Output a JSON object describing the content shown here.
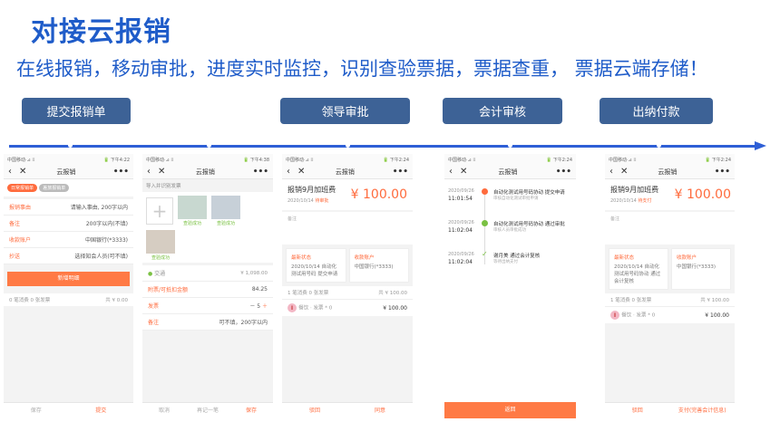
{
  "page": {
    "title": "对接云报销",
    "subtitle": "在线报销，移动审批，进度实时监控，识别查验票据，票据查重， 票据云端存储！"
  },
  "steps": [
    "提交报销单",
    "领导审批",
    "会计审核",
    "出纳付款"
  ],
  "colors": {
    "accent": "#1f5cc9",
    "step_bg": "#3d6296",
    "timeline": "#2e5fd6",
    "orange": "#ff6b3d",
    "green": "#7ac143"
  },
  "status": {
    "s1": {
      "l": "中国移动·⊿ ⁞⁞",
      "r": "🔋 下午4:22"
    },
    "s2": {
      "l": "中国移动·⊿ ⁞⁞",
      "r": "🔋 下午4:38"
    },
    "s3": {
      "l": "中国移动·⊿ ⁞⁞",
      "r": "🔋 下午2:24"
    },
    "s4": {
      "l": "中国移动·⊿ ⁞⁞",
      "r": "🔋 下午2:24"
    },
    "s5": {
      "l": "中国移动·⊿ ⁞⁞",
      "r": "🔋 下午2:24"
    }
  },
  "nav_title": "云报销",
  "p1": {
    "tab1": "日常报销单",
    "tab2": "差旅报销单",
    "rows": [
      {
        "l": "报销事由",
        "v": "请输入事由, 200字以内"
      },
      {
        "l": "备注",
        "v": "200字以内(不填)"
      },
      {
        "l": "收款账户",
        "v": "中国银行(*3333)"
      },
      {
        "l": "抄送",
        "v": "选择知会人员(可不填)"
      }
    ],
    "add": "新增明细",
    "summary": "0 笔消费 0 张发票",
    "total": "共 ¥ 0.00",
    "save": "保存",
    "submit": "提交"
  },
  "p2": {
    "head": "导入并识别发票",
    "ok": "查验成功",
    "traffic": "交通",
    "traffic_amt": "¥ 1,098.00",
    "deduct": "附票/可抵扣金额",
    "deduct_amt": "84.25",
    "invoice": "发票",
    "qty": "5",
    "remark": "备注",
    "remark_v": "可不填，200字以内",
    "cancel": "取消",
    "again": "再记一笔",
    "save": "保存"
  },
  "p3": {
    "title": "报销9月加班费",
    "amount": "¥ 100.00",
    "date": "2020/10/14",
    "status": "待审批",
    "remark": "备注",
    "latest": "最新状态",
    "latest_v": "2020/10/14 自动化测试用号码 提交申请",
    "account": "收款账户",
    "account_v": "中国银行(*3333)",
    "sum": "1 笔消费 0 张发票",
    "sum_amt": "共 ¥ 100.00",
    "item": "餐饮 · 发票 * 0",
    "item_amt": "¥ 100.00",
    "reject": "驳回",
    "agree": "同意"
  },
  "p4": {
    "events": [
      {
        "d": "2020/09/26",
        "t": "11:01:54",
        "txt": "自动化测试用号码协动 提交申请",
        "sub": "审核自动化测试审批申请"
      },
      {
        "d": "2020/09/26",
        "t": "11:02:04",
        "txt": "自动化测试用号码协动 通过审批",
        "sub": "审核人员审批成功"
      },
      {
        "d": "2020/09/26",
        "t": "11:02:04",
        "txt": "谢月美 通过会计复核",
        "sub": "等待出纳支付"
      }
    ],
    "back": "返回"
  },
  "p5": {
    "title": "报销9月加班费",
    "amount": "¥ 100.00",
    "date": "2020/10/14",
    "status": "待支付",
    "remark": "备注",
    "latest": "最新状态",
    "latest_v": "2020/10/14 自动化测试用号码协动 通过会计复核",
    "account": "收款账户",
    "account_v": "中国银行(*3333)",
    "sum": "1 笔消费 0 张发票",
    "sum_amt": "共 ¥ 100.00",
    "item": "餐饮 · 发票 * 0",
    "item_amt": "¥ 100.00",
    "reject": "驳回",
    "pay": "支付(完善会计信息)"
  }
}
